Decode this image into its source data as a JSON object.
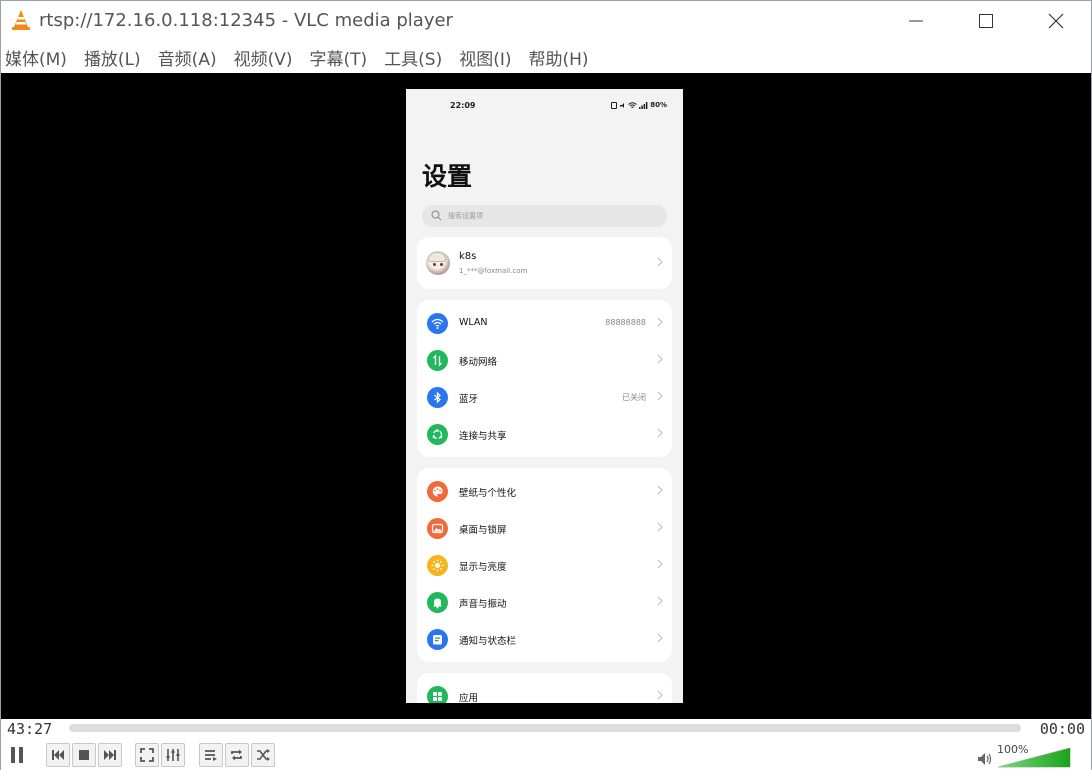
{
  "window": {
    "title": "rtsp://172.16.0.118:12345 - VLC media player"
  },
  "menu": [
    {
      "label": "媒体(M)"
    },
    {
      "label": "播放(L)"
    },
    {
      "label": "音频(A)"
    },
    {
      "label": "视频(V)"
    },
    {
      "label": "字幕(T)"
    },
    {
      "label": "工具(S)"
    },
    {
      "label": "视图(I)"
    },
    {
      "label": "帮助(H)"
    }
  ],
  "phone": {
    "status": {
      "time": "22:09",
      "battery": "80%"
    },
    "title": "设置",
    "search_placeholder": "搜索设置项",
    "profile": {
      "name": "k8s",
      "email": "1_***@foxmail.com"
    },
    "network": [
      {
        "label": "WLAN",
        "value": "88888888",
        "icon": "wifi-icon",
        "color": "#2a76ef"
      },
      {
        "label": "移动网络",
        "value": "",
        "icon": "mobile-data-icon",
        "color": "#21b85b"
      },
      {
        "label": "蓝牙",
        "value": "已关闭",
        "icon": "bluetooth-icon",
        "color": "#2a76ef"
      },
      {
        "label": "连接与共享",
        "value": "",
        "icon": "share-icon",
        "color": "#21b85b"
      }
    ],
    "display": [
      {
        "label": "壁纸与个性化",
        "icon": "palette-icon",
        "color": "#f06a3c"
      },
      {
        "label": "桌面与锁屏",
        "icon": "image-icon",
        "color": "#f06a3c"
      },
      {
        "label": "显示与亮度",
        "icon": "sun-icon",
        "color": "#f5b51b"
      },
      {
        "label": "声音与振动",
        "icon": "bell-icon",
        "color": "#21b85b"
      },
      {
        "label": "通知与状态栏",
        "icon": "notification-icon",
        "color": "#2a76ef"
      }
    ],
    "apps": {
      "label": "应用",
      "icon": "apps-icon",
      "color": "#21b85b"
    }
  },
  "player": {
    "elapsed": "43:27",
    "total": "00:00",
    "progress": 0.0,
    "volume_label": "100%",
    "volume": 1.0
  }
}
